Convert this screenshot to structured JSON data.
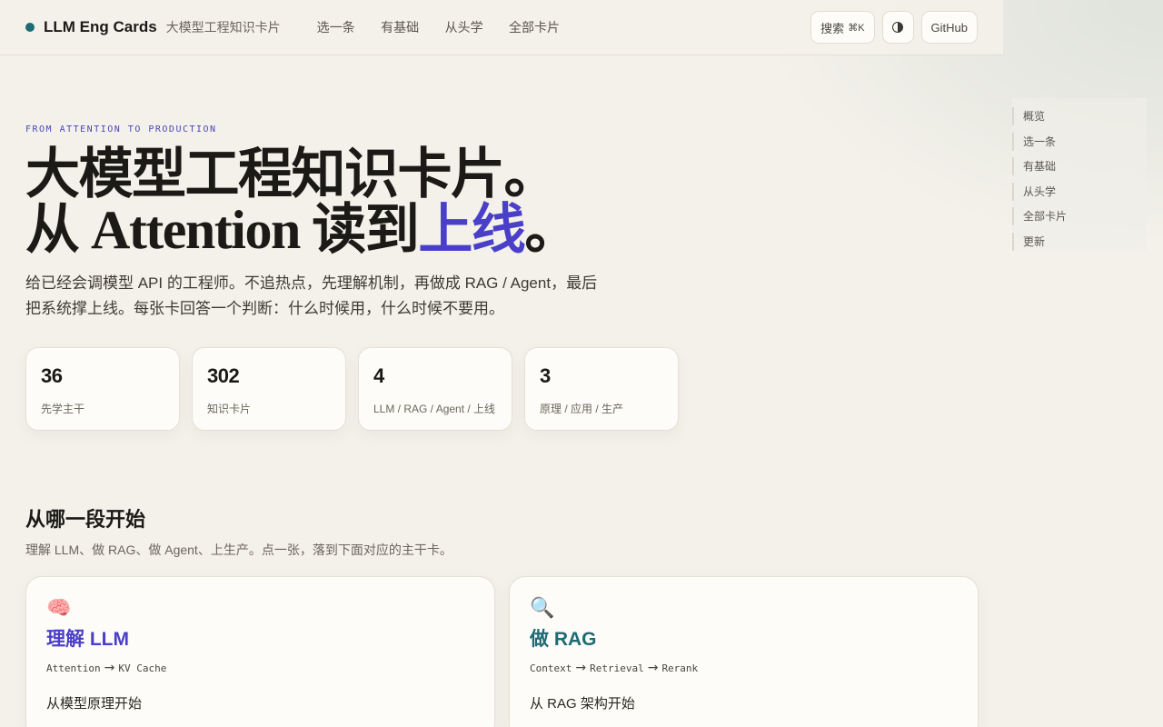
{
  "header": {
    "brand_name": "LLM Eng Cards",
    "brand_sub": "大模型工程知识卡片",
    "nav": [
      "选一条",
      "有基础",
      "从头学",
      "全部卡片"
    ],
    "search_label": "搜索",
    "search_shortcut": "⌘K",
    "theme_icon": "contrast-icon",
    "github_label": "GitHub"
  },
  "toc": [
    "概览",
    "选一条",
    "有基础",
    "从头学",
    "全部卡片",
    "更新"
  ],
  "hero": {
    "eyebrow": "FROM ATTENTION TO PRODUCTION",
    "title_line1": "大模型工程知识卡片。",
    "title_line2_pre": "从 Attention 读到",
    "title_line2_accent": "上线",
    "title_line2_post": "。",
    "description": "给已经会调模型 API 的工程师。不追热点，先理解机制，再做成 RAG / Agent，最后把系统撑上线。每张卡回答一个判断：什么时候用，什么时候不要用。"
  },
  "stats": [
    {
      "value": "36",
      "label": "先学主干"
    },
    {
      "value": "302",
      "label": "知识卡片"
    },
    {
      "value": "4",
      "label": "LLM / RAG / Agent / 上线"
    },
    {
      "value": "3",
      "label": "原理 / 应用 / 生产"
    }
  ],
  "section": {
    "title": "从哪一段开始",
    "description": "理解 LLM、做 RAG、做 Agent、上生产。点一张，落到下面对应的主干卡。"
  },
  "paths": [
    {
      "emoji": "🧠",
      "title": "理解 LLM",
      "flow": [
        "Attention",
        "KV Cache"
      ],
      "cta": "从模型原理开始"
    },
    {
      "emoji": "🔍",
      "title": "做 RAG",
      "flow": [
        "Context",
        "Retrieval",
        "Rerank"
      ],
      "cta": "从 RAG 架构开始"
    }
  ],
  "colors": {
    "accent_purple": "#4a3fc8",
    "accent_teal": "#1e6b73",
    "background": "#f4f1ea"
  }
}
